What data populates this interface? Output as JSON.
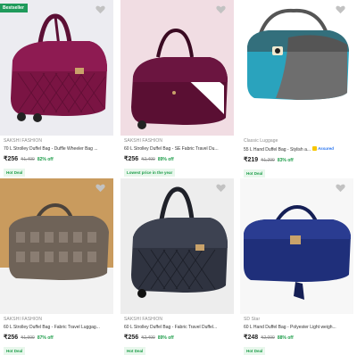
{
  "products": [
    {
      "badge": "Bestseller",
      "brand": "SAKSHI FASHION",
      "title": "70 L Strolley Duffel Bag - Duffle Wheeler Bag ...",
      "price": "₹256",
      "mrp": "₹1,499",
      "discount": "82% off",
      "tag": "Hot Deal",
      "assured": "",
      "image_icon": "purple-quilted-duffel-bag-image",
      "colors": {
        "bg": "#e9e9ee",
        "bag": "#7a1443"
      }
    },
    {
      "badge": "",
      "brand": "SAKSHI FASHION",
      "title": "60 L Strolley Duffel Bag - SE Fabric Travel Du...",
      "price": "₹256",
      "mrp": "₹2,499",
      "discount": "89% off",
      "tag": "Lowest price in the year",
      "assured": "",
      "image_icon": "maroon-duffel-bag-image",
      "colors": {
        "bg": "#f1dde3",
        "bag": "#5a0f33"
      }
    },
    {
      "badge": "",
      "brand": "Classic Luggage",
      "title": "55 L Hand Duffel Bag - Stylish a...",
      "price": "₹219",
      "mrp": "₹1,299",
      "discount": "83% off",
      "tag": "Hot Deal",
      "assured": "Assured",
      "image_icon": "teal-grey-duffel-bag-image",
      "colors": {
        "bg": "#ffffff",
        "bag": "#2aa3bd"
      }
    },
    {
      "badge": "",
      "brand": "SAKSHI FASHION",
      "title": "60 L Strolley Duffel Bag - Fabric Travel Luggag...",
      "price": "₹256",
      "mrp": "₹1,999",
      "discount": "87% off",
      "tag": "Hot Deal",
      "assured": "",
      "image_icon": "grey-quilted-duffel-bag-image",
      "colors": {
        "bg": "#c99b5e",
        "bag": "#6f6358"
      }
    },
    {
      "badge": "",
      "brand": "SAKSHI FASHION",
      "title": "60 L Strolley Duffel Bag - Fabric Travel Duffel...",
      "price": "₹256",
      "mrp": "₹2,499",
      "discount": "89% off",
      "tag": "Hot Deal",
      "assured": "",
      "image_icon": "black-quilted-duffel-bag-image",
      "colors": {
        "bg": "#ededed",
        "bag": "#2f3340"
      }
    },
    {
      "badge": "",
      "brand": "SD Star",
      "title": "60 L Hand Duffel Bag - Polyester Light weigh...",
      "price": "₹248",
      "mrp": "₹2,099",
      "discount": "88% off",
      "tag": "Hot Deal",
      "assured": "",
      "image_icon": "navy-blue-duffel-bag-image",
      "colors": {
        "bg": "#f7f7f7",
        "bag": "#1f2f7a"
      }
    }
  ]
}
